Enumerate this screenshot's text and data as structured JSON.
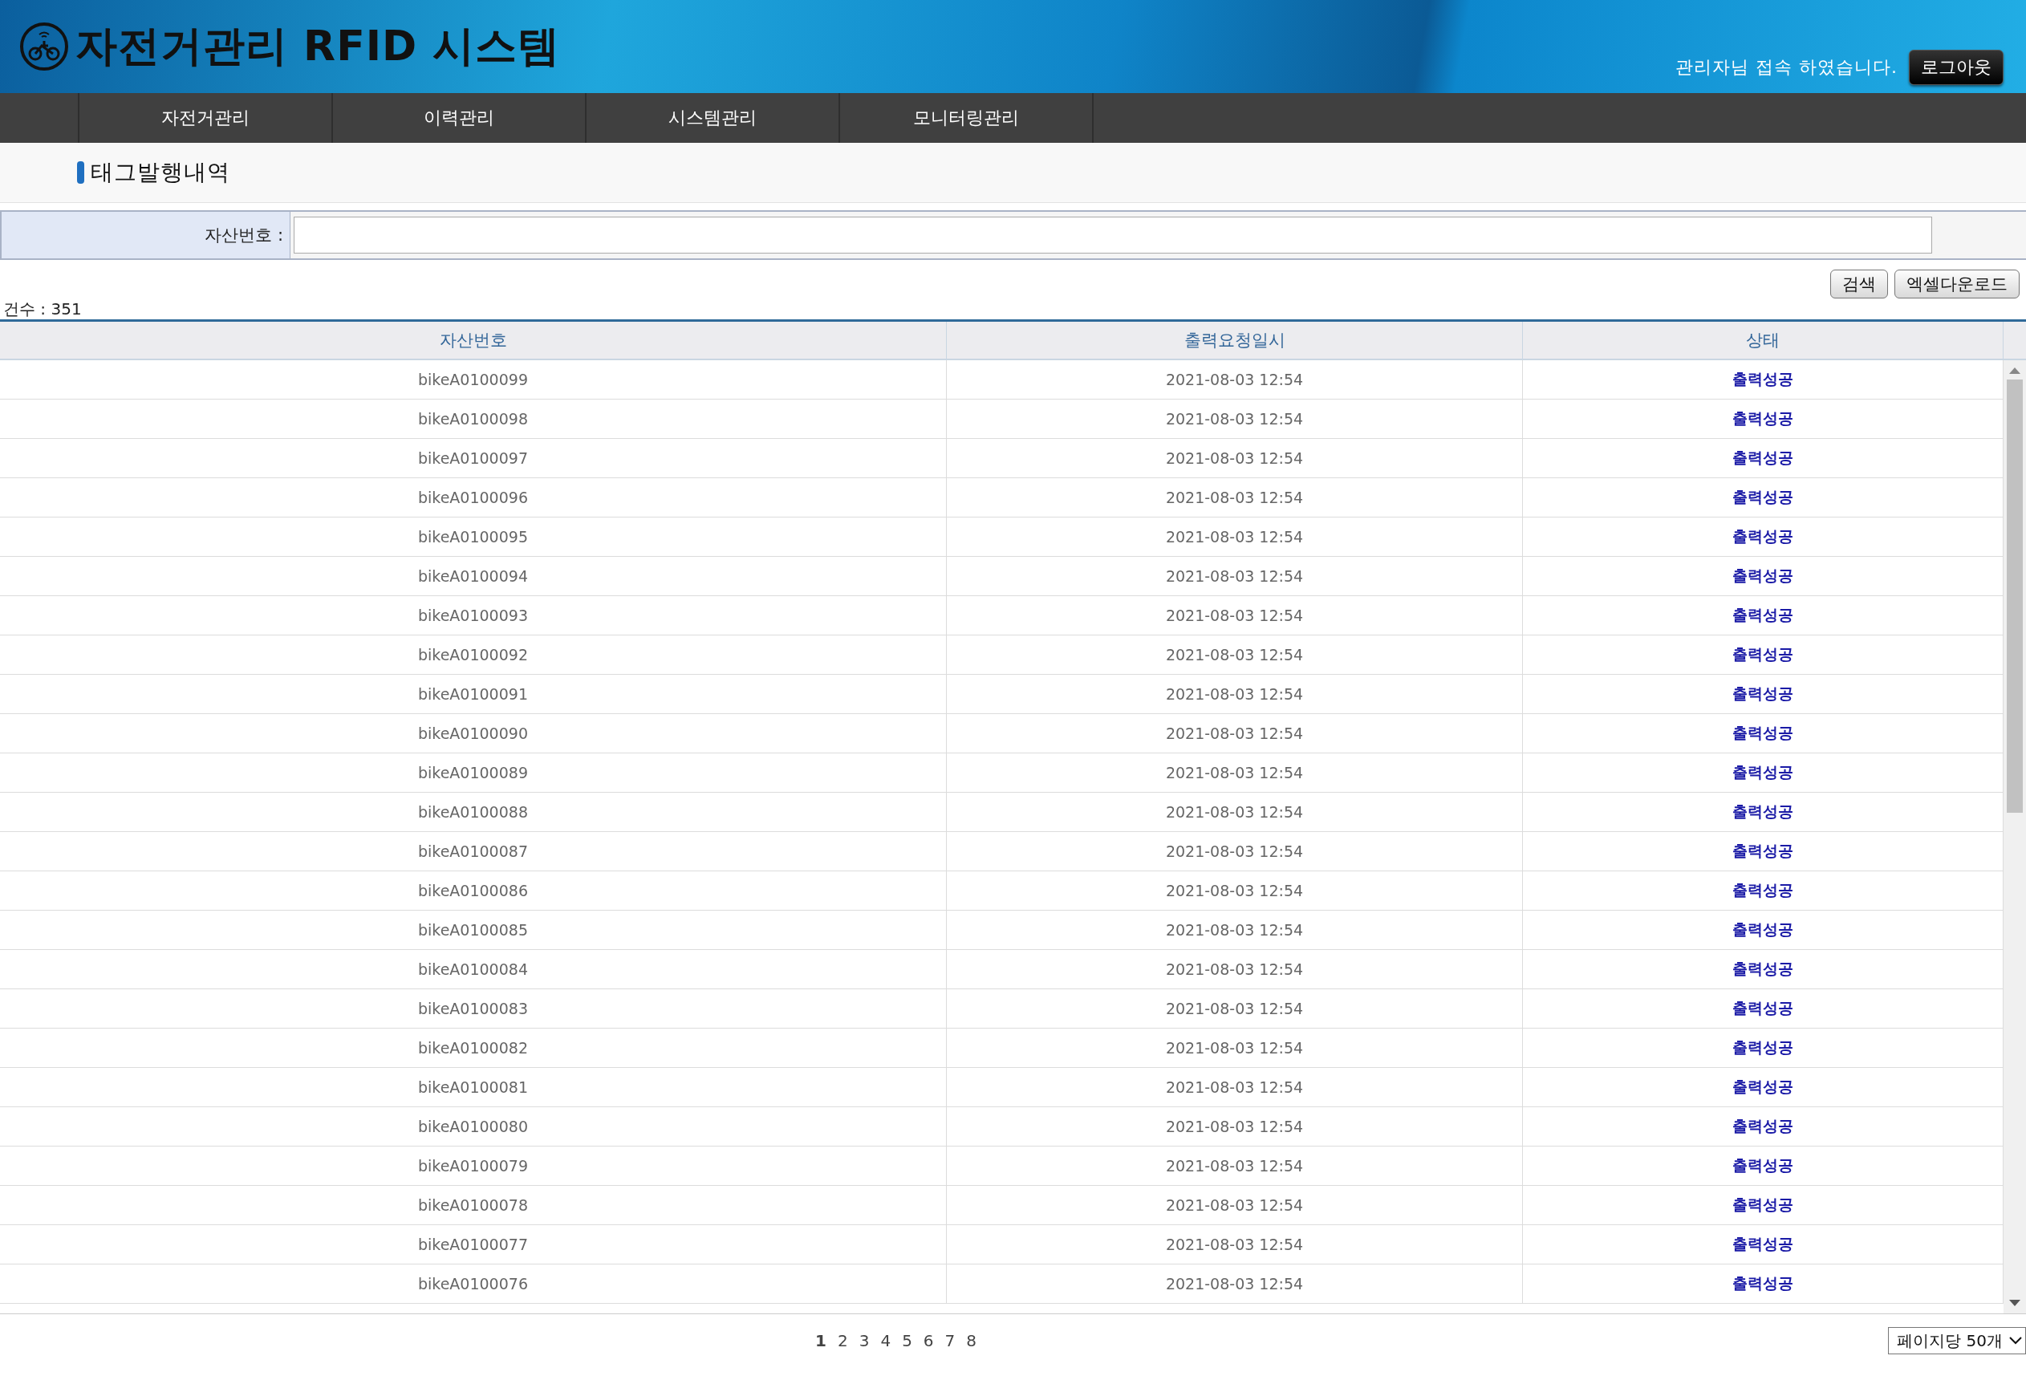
{
  "header": {
    "title": "자전거관리 RFID 시스템",
    "welcome": "관리자님 접속 하였습니다.",
    "logout": "로그아웃"
  },
  "nav": [
    {
      "label": "자전거관리",
      "selected": false
    },
    {
      "label": "이력관리",
      "selected": false
    },
    {
      "label": "시스템관리",
      "selected": false
    },
    {
      "label": "모니터링관리",
      "selected": false
    }
  ],
  "page_title": "태그발행내역",
  "search": {
    "label": "자산번호 :"
  },
  "buttons": [
    "검색",
    "엑셀다운로드"
  ],
  "total": "건수 : 351",
  "table": {
    "columns": [
      "자산번호",
      "출력요청일시",
      "상태"
    ],
    "rows": [
      [
        "bikeA0100099",
        "2021-08-03 12:54",
        "출력성공"
      ],
      [
        "bikeA0100098",
        "2021-08-03 12:54",
        "출력성공"
      ],
      [
        "bikeA0100097",
        "2021-08-03 12:54",
        "출력성공"
      ],
      [
        "bikeA0100096",
        "2021-08-03 12:54",
        "출력성공"
      ],
      [
        "bikeA0100095",
        "2021-08-03 12:54",
        "출력성공"
      ],
      [
        "bikeA0100094",
        "2021-08-03 12:54",
        "출력성공"
      ],
      [
        "bikeA0100093",
        "2021-08-03 12:54",
        "출력성공"
      ],
      [
        "bikeA0100092",
        "2021-08-03 12:54",
        "출력성공"
      ],
      [
        "bikeA0100091",
        "2021-08-03 12:54",
        "출력성공"
      ],
      [
        "bikeA0100090",
        "2021-08-03 12:54",
        "출력성공"
      ],
      [
        "bikeA0100089",
        "2021-08-03 12:54",
        "출력성공"
      ],
      [
        "bikeA0100088",
        "2021-08-03 12:54",
        "출력성공"
      ],
      [
        "bikeA0100087",
        "2021-08-03 12:54",
        "출력성공"
      ],
      [
        "bikeA0100086",
        "2021-08-03 12:54",
        "출력성공"
      ],
      [
        "bikeA0100085",
        "2021-08-03 12:54",
        "출력성공"
      ],
      [
        "bikeA0100084",
        "2021-08-03 12:54",
        "출력성공"
      ],
      [
        "bikeA0100083",
        "2021-08-03 12:54",
        "출력성공"
      ],
      [
        "bikeA0100082",
        "2021-08-03 12:54",
        "출력성공"
      ],
      [
        "bikeA0100081",
        "2021-08-03 12:54",
        "출력성공"
      ],
      [
        "bikeA0100080",
        "2021-08-03 12:54",
        "출력성공"
      ],
      [
        "bikeA0100079",
        "2021-08-03 12:54",
        "출력성공"
      ],
      [
        "bikeA0100078",
        "2021-08-03 12:54",
        "출력성공"
      ],
      [
        "bikeA0100077",
        "2021-08-03 12:54",
        "출력성공"
      ],
      [
        "bikeA0100076",
        "2021-08-03 12:54",
        "출력성공"
      ]
    ]
  },
  "pagination": [
    {
      "label": "1",
      "selected": true
    },
    {
      "label": "2",
      "selected": false
    },
    {
      "label": "3",
      "selected": false
    },
    {
      "label": "4",
      "selected": false
    },
    {
      "label": "5",
      "selected": false
    },
    {
      "label": "6",
      "selected": false
    },
    {
      "label": "7",
      "selected": false
    },
    {
      "label": "8",
      "selected": false
    }
  ],
  "page_size": "페이지당 50개"
}
